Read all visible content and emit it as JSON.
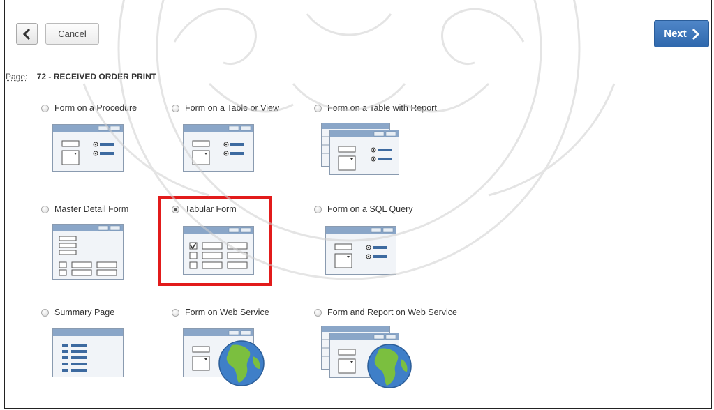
{
  "toolbar": {
    "back_icon": "chevron-left-icon",
    "cancel_label": "Cancel",
    "next_label": "Next",
    "next_icon": "chevron-right-icon"
  },
  "page": {
    "label": "Page:",
    "value": "72 - RECEIVED ORDER PRINT"
  },
  "options": [
    {
      "label": "Form on a Procedure",
      "selected": false
    },
    {
      "label": "Form on a Table or View",
      "selected": false
    },
    {
      "label": "Form on a Table with Report",
      "selected": false
    },
    {
      "label": "Master Detail Form",
      "selected": false
    },
    {
      "label": "Tabular Form",
      "selected": true
    },
    {
      "label": "Form on a SQL Query",
      "selected": false
    },
    {
      "label": "Summary Page",
      "selected": false
    },
    {
      "label": "Form on Web Service",
      "selected": false
    },
    {
      "label": "Form and Report on Web Service",
      "selected": false
    }
  ],
  "colors": {
    "accent": "#3a74b8",
    "highlight": "#e21b1b",
    "thumb_header": "#8aa6c8"
  }
}
